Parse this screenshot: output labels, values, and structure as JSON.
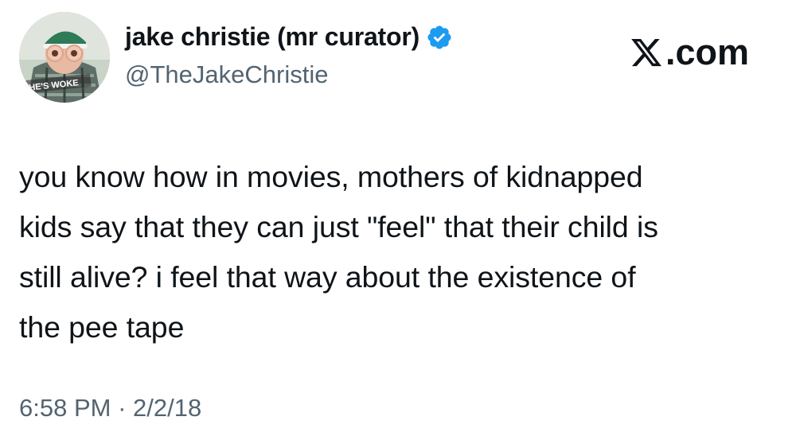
{
  "author": {
    "display_name": "jake christie (mr curator)",
    "handle": "@TheJakeChristie",
    "avatar_caption": "HE'S WOKE",
    "verified": true
  },
  "brand": {
    "suffix": ".com",
    "logo_icon": "x-logo-icon"
  },
  "tweet": {
    "lines": [
      "you know how in movies, mothers of kidnapped",
      "kids say that they can just \"feel\" that their child is",
      "still alive? i feel that way about the existence of",
      "the pee tape"
    ],
    "time": "6:58 PM",
    "separator": "·",
    "date": "2/2/18"
  },
  "colors": {
    "text": "#0f1419",
    "secondary": "#536471",
    "verified_blue": "#1d9bf0"
  }
}
